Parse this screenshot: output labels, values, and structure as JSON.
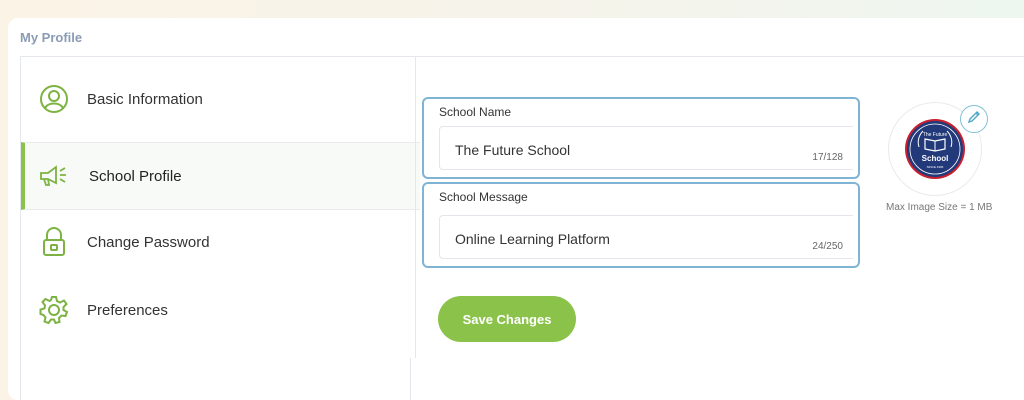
{
  "page": {
    "title": "My Profile"
  },
  "sidebar": {
    "items": [
      {
        "label": "Basic Information",
        "icon": "user-circle-icon",
        "active": false
      },
      {
        "label": "School Profile",
        "icon": "megaphone-icon",
        "active": true
      },
      {
        "label": "Change Password",
        "icon": "lock-icon",
        "active": false
      },
      {
        "label": "Preferences",
        "icon": "gear-icon",
        "active": false
      }
    ]
  },
  "form": {
    "school_name": {
      "label": "School Name",
      "value": "The Future School",
      "count": "17/128"
    },
    "school_message": {
      "label": "School Message",
      "value": "Online Learning Platform",
      "count": "24/250"
    },
    "save_label": "Save Changes"
  },
  "logo": {
    "top_text": "The Future",
    "main_text": "School",
    "bottom_text": "SINCE 1995",
    "max_size_text": "Max Image Size = 1 MB"
  },
  "colors": {
    "accent_green": "#8bc34a",
    "focus_blue": "#7fb4d4",
    "logo_navy": "#233a7a",
    "logo_red": "#c8202f"
  }
}
